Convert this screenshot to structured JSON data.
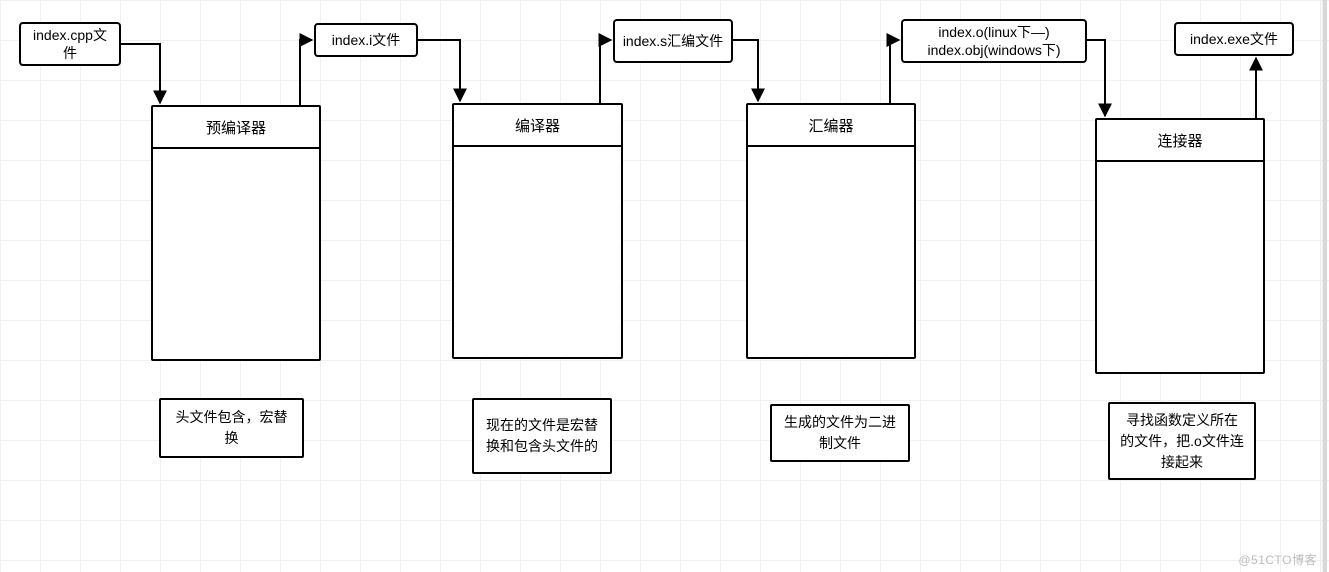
{
  "file_cpp": "index.cpp文件",
  "file_i": "index.i文件",
  "file_s": "index.s汇编文件",
  "file_o": "index.o(linux下—)\nindex.obj(windows下)",
  "file_exe": "index.exe文件",
  "stage1": "预编译器",
  "stage2": "编译器",
  "stage3": "汇编器",
  "stage4": "连接器",
  "note1": "头文件包含，宏替换",
  "note2": "现在的文件是宏替换和包含头文件的",
  "note3": "生成的文件为二进制文件",
  "note4": "寻找函数定义所在的文件，把.o文件连接起来",
  "watermark": "@51CTO博客"
}
